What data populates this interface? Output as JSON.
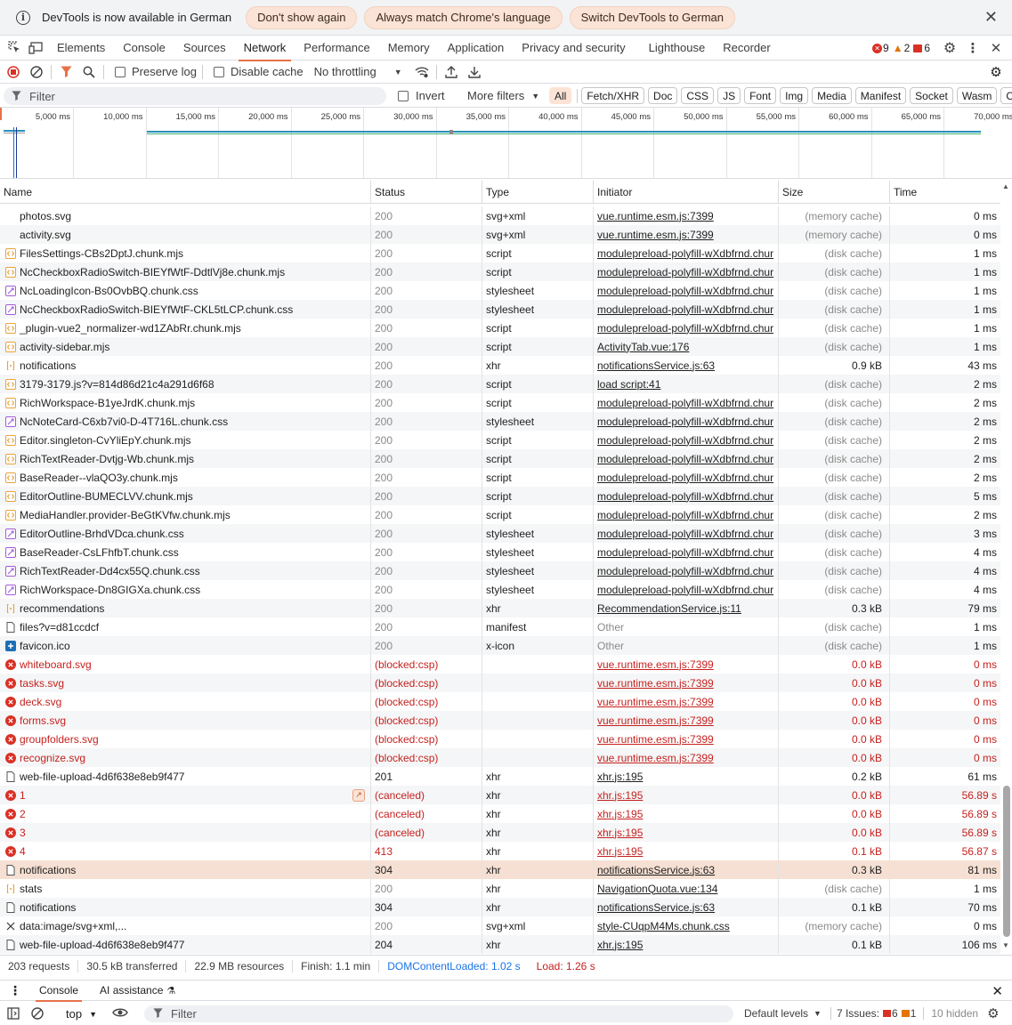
{
  "infobar": {
    "text": "DevTools is now available in German",
    "dont_show": "Don't show again",
    "match_lang": "Always match Chrome's language",
    "switch": "Switch DevTools to German"
  },
  "tabs": [
    "Elements",
    "Console",
    "Sources",
    "Network",
    "Performance",
    "Memory",
    "Application",
    "Privacy and security",
    "Lighthouse",
    "Recorder"
  ],
  "active_tab": "Network",
  "badges": {
    "errors": "9",
    "warnings": "2",
    "issues": "6"
  },
  "toolbar": {
    "preserve_log": "Preserve log",
    "disable_cache": "Disable cache",
    "throttling": "No throttling"
  },
  "filterbar": {
    "placeholder": "Filter",
    "invert": "Invert",
    "more_filters": "More filters",
    "types": [
      "All",
      "Fetch/XHR",
      "Doc",
      "CSS",
      "JS",
      "Font",
      "Img",
      "Media",
      "Manifest",
      "Socket",
      "Wasm",
      "Other"
    ]
  },
  "overview": {
    "ticks": [
      "5,000 ms",
      "10,000 ms",
      "15,000 ms",
      "20,000 ms",
      "25,000 ms",
      "30,000 ms",
      "35,000 ms",
      "40,000 ms",
      "45,000 ms",
      "50,000 ms",
      "55,000 ms",
      "60,000 ms",
      "65,000 ms",
      "70,000 ms"
    ]
  },
  "columns": {
    "name": "Name",
    "status": "Status",
    "type": "Type",
    "initiator": "Initiator",
    "size": "Size",
    "time": "Time"
  },
  "rows": [
    {
      "icon": "blank",
      "name": "photos.svg",
      "status": "200",
      "type": "svg+xml",
      "init": "vue.runtime.esm.js:7399",
      "size": "(memory cache)",
      "time": "0 ms"
    },
    {
      "icon": "blank",
      "name": "activity.svg",
      "status": "200",
      "type": "svg+xml",
      "init": "vue.runtime.esm.js:7399",
      "size": "(memory cache)",
      "time": "0 ms"
    },
    {
      "icon": "script",
      "name": "FilesSettings-CBs2DptJ.chunk.mjs",
      "status": "200",
      "type": "script",
      "init": "modulepreload-polyfill-wXdbfrnd.chur",
      "size": "(disk cache)",
      "time": "1 ms"
    },
    {
      "icon": "script",
      "name": "NcCheckboxRadioSwitch-BIEYfWtF-DdtlVj8e.chunk.mjs",
      "status": "200",
      "type": "script",
      "init": "modulepreload-polyfill-wXdbfrnd.chur",
      "size": "(disk cache)",
      "time": "1 ms"
    },
    {
      "icon": "css",
      "name": "NcLoadingIcon-Bs0OvbBQ.chunk.css",
      "status": "200",
      "type": "stylesheet",
      "init": "modulepreload-polyfill-wXdbfrnd.chur",
      "size": "(disk cache)",
      "time": "1 ms"
    },
    {
      "icon": "css",
      "name": "NcCheckboxRadioSwitch-BIEYfWtF-CKL5tLCP.chunk.css",
      "status": "200",
      "type": "stylesheet",
      "init": "modulepreload-polyfill-wXdbfrnd.chur",
      "size": "(disk cache)",
      "time": "1 ms"
    },
    {
      "icon": "script",
      "name": "_plugin-vue2_normalizer-wd1ZAbRr.chunk.mjs",
      "status": "200",
      "type": "script",
      "init": "modulepreload-polyfill-wXdbfrnd.chur",
      "size": "(disk cache)",
      "time": "1 ms"
    },
    {
      "icon": "script",
      "name": "activity-sidebar.mjs",
      "status": "200",
      "type": "script",
      "init": "ActivityTab.vue:176",
      "size": "(disk cache)",
      "time": "1 ms"
    },
    {
      "icon": "xhr",
      "name": "notifications",
      "status": "200",
      "type": "xhr",
      "init": "notificationsService.js:63",
      "size": "0.9 kB",
      "time": "43 ms"
    },
    {
      "icon": "script",
      "name": "3179-3179.js?v=814d86d21c4a291d6f68",
      "status": "200",
      "type": "script",
      "init": "load script:41",
      "size": "(disk cache)",
      "time": "2 ms"
    },
    {
      "icon": "script",
      "name": "RichWorkspace-B1yeJrdK.chunk.mjs",
      "status": "200",
      "type": "script",
      "init": "modulepreload-polyfill-wXdbfrnd.chur",
      "size": "(disk cache)",
      "time": "2 ms"
    },
    {
      "icon": "css",
      "name": "NcNoteCard-C6xb7vi0-D-4T716L.chunk.css",
      "status": "200",
      "type": "stylesheet",
      "init": "modulepreload-polyfill-wXdbfrnd.chur",
      "size": "(disk cache)",
      "time": "2 ms"
    },
    {
      "icon": "script",
      "name": "Editor.singleton-CvYliEpY.chunk.mjs",
      "status": "200",
      "type": "script",
      "init": "modulepreload-polyfill-wXdbfrnd.chur",
      "size": "(disk cache)",
      "time": "2 ms"
    },
    {
      "icon": "script",
      "name": "RichTextReader-Dvtjg-Wb.chunk.mjs",
      "status": "200",
      "type": "script",
      "init": "modulepreload-polyfill-wXdbfrnd.chur",
      "size": "(disk cache)",
      "time": "2 ms"
    },
    {
      "icon": "script",
      "name": "BaseReader--vlaQO3y.chunk.mjs",
      "status": "200",
      "type": "script",
      "init": "modulepreload-polyfill-wXdbfrnd.chur",
      "size": "(disk cache)",
      "time": "2 ms"
    },
    {
      "icon": "script",
      "name": "EditorOutline-BUMECLVV.chunk.mjs",
      "status": "200",
      "type": "script",
      "init": "modulepreload-polyfill-wXdbfrnd.chur",
      "size": "(disk cache)",
      "time": "5 ms"
    },
    {
      "icon": "script",
      "name": "MediaHandler.provider-BeGtKVfw.chunk.mjs",
      "status": "200",
      "type": "script",
      "init": "modulepreload-polyfill-wXdbfrnd.chur",
      "size": "(disk cache)",
      "time": "2 ms"
    },
    {
      "icon": "css",
      "name": "EditorOutline-BrhdVDca.chunk.css",
      "status": "200",
      "type": "stylesheet",
      "init": "modulepreload-polyfill-wXdbfrnd.chur",
      "size": "(disk cache)",
      "time": "3 ms"
    },
    {
      "icon": "css",
      "name": "BaseReader-CsLFhfbT.chunk.css",
      "status": "200",
      "type": "stylesheet",
      "init": "modulepreload-polyfill-wXdbfrnd.chur",
      "size": "(disk cache)",
      "time": "4 ms"
    },
    {
      "icon": "css",
      "name": "RichTextReader-Dd4cx55Q.chunk.css",
      "status": "200",
      "type": "stylesheet",
      "init": "modulepreload-polyfill-wXdbfrnd.chur",
      "size": "(disk cache)",
      "time": "4 ms"
    },
    {
      "icon": "css",
      "name": "RichWorkspace-Dn8GIGXa.chunk.css",
      "status": "200",
      "type": "stylesheet",
      "init": "modulepreload-polyfill-wXdbfrnd.chur",
      "size": "(disk cache)",
      "time": "4 ms"
    },
    {
      "icon": "xhr",
      "name": "recommendations",
      "status": "200",
      "type": "xhr",
      "init": "RecommendationService.js:11",
      "size": "0.3 kB",
      "time": "79 ms"
    },
    {
      "icon": "doc",
      "name": "files?v=d81ccdcf",
      "status": "200",
      "type": "manifest",
      "init": "Other",
      "size": "(disk cache)",
      "time": "1 ms"
    },
    {
      "icon": "favicon",
      "name": "favicon.ico",
      "status": "200",
      "type": "x-icon",
      "init": "Other",
      "size": "(disk cache)",
      "time": "1 ms"
    },
    {
      "icon": "error",
      "name": "whiteboard.svg",
      "status": "(blocked:csp)",
      "type": "",
      "init": "vue.runtime.esm.js:7399",
      "size": "0.0 kB",
      "time": "0 ms",
      "error": true
    },
    {
      "icon": "error",
      "name": "tasks.svg",
      "status": "(blocked:csp)",
      "type": "",
      "init": "vue.runtime.esm.js:7399",
      "size": "0.0 kB",
      "time": "0 ms",
      "error": true
    },
    {
      "icon": "error",
      "name": "deck.svg",
      "status": "(blocked:csp)",
      "type": "",
      "init": "vue.runtime.esm.js:7399",
      "size": "0.0 kB",
      "time": "0 ms",
      "error": true
    },
    {
      "icon": "error",
      "name": "forms.svg",
      "status": "(blocked:csp)",
      "type": "",
      "init": "vue.runtime.esm.js:7399",
      "size": "0.0 kB",
      "time": "0 ms",
      "error": true
    },
    {
      "icon": "error",
      "name": "groupfolders.svg",
      "status": "(blocked:csp)",
      "type": "",
      "init": "vue.runtime.esm.js:7399",
      "size": "0.0 kB",
      "time": "0 ms",
      "error": true
    },
    {
      "icon": "error",
      "name": "recognize.svg",
      "status": "(blocked:csp)",
      "type": "",
      "init": "vue.runtime.esm.js:7399",
      "size": "0.0 kB",
      "time": "0 ms",
      "error": true
    },
    {
      "icon": "doc",
      "name": "web-file-upload-4d6f638e8eb9f477",
      "status": "201",
      "type": "xhr",
      "init": "xhr.js:195",
      "size": "0.2 kB",
      "time": "61 ms"
    },
    {
      "icon": "error",
      "name": "1",
      "status": "(canceled)",
      "type": "xhr",
      "init": "xhr.js:195",
      "size": "0.0 kB",
      "time": "56.89 s",
      "error": true,
      "marker": true
    },
    {
      "icon": "error",
      "name": "2",
      "status": "(canceled)",
      "type": "xhr",
      "init": "xhr.js:195",
      "size": "0.0 kB",
      "time": "56.89 s",
      "error": true
    },
    {
      "icon": "error",
      "name": "3",
      "status": "(canceled)",
      "type": "xhr",
      "init": "xhr.js:195",
      "size": "0.0 kB",
      "time": "56.89 s",
      "error": true
    },
    {
      "icon": "error",
      "name": "4",
      "status": "413",
      "type": "xhr",
      "init": "xhr.js:195",
      "size": "0.1 kB",
      "time": "56.87 s",
      "error": true
    },
    {
      "icon": "doc",
      "name": "notifications",
      "status": "304",
      "type": "xhr",
      "init": "notificationsService.js:63",
      "size": "0.3 kB",
      "time": "81 ms",
      "selected": true
    },
    {
      "icon": "xhr",
      "name": "stats",
      "status": "200",
      "type": "xhr",
      "init": "NavigationQuota.vue:134",
      "size": "(disk cache)",
      "time": "1 ms"
    },
    {
      "icon": "doc",
      "name": "notifications",
      "status": "304",
      "type": "xhr",
      "init": "notificationsService.js:63",
      "size": "0.1 kB",
      "time": "70 ms"
    },
    {
      "icon": "x",
      "name": "data:image/svg+xml,...",
      "status": "200",
      "type": "svg+xml",
      "init": "style-CUqpM4Ms.chunk.css",
      "size": "(memory cache)",
      "time": "0 ms"
    },
    {
      "icon": "doc",
      "name": "web-file-upload-4d6f638e8eb9f477",
      "status": "204",
      "type": "xhr",
      "init": "xhr.js:195",
      "size": "0.1 kB",
      "time": "106 ms"
    }
  ],
  "summary": {
    "requests": "203 requests",
    "transferred": "30.5 kB transferred",
    "resources": "22.9 MB resources",
    "finish": "Finish: 1.1 min",
    "dcl": "DOMContentLoaded: 1.02 s",
    "load": "Load: 1.26 s"
  },
  "drawer": {
    "console_tab": "Console",
    "ai_tab": "AI assistance",
    "context": "top",
    "filter_placeholder": "Filter",
    "levels": "Default levels",
    "issues_label": "7 Issues:",
    "issues_errors": "6",
    "issues_warnings": "1",
    "hidden": "10 hidden"
  },
  "colors": {
    "accent": "#e8714a",
    "error": "#c5221f",
    "link": "#1a73e8",
    "selected_row": "#f6e0d3"
  }
}
